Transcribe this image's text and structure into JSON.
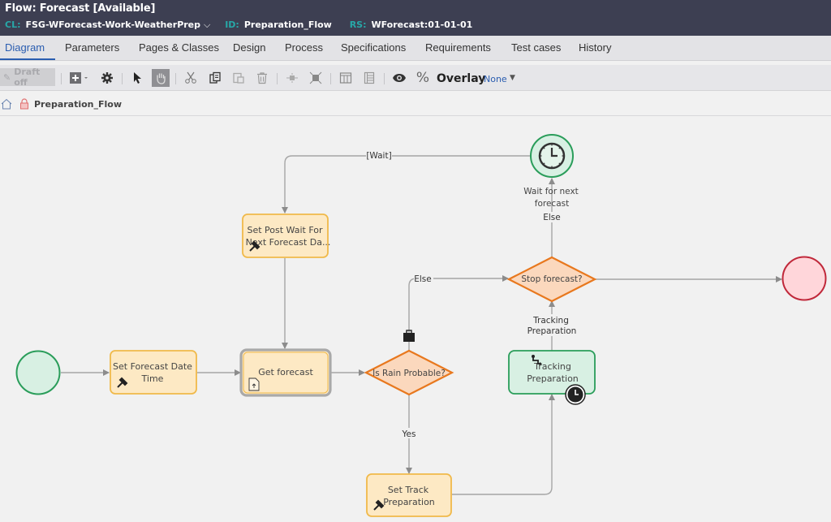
{
  "header": {
    "title": "Flow: Forecast [Available]",
    "cl_label": "CL:",
    "cl_value": "FSG-WForecast-Work-WeatherPrep",
    "id_label": "ID:",
    "id_value": "Preparation_Flow",
    "rs_label": "RS:",
    "rs_value": "WForecast:01-01-01"
  },
  "tabs": [
    {
      "label": "Diagram",
      "active": true
    },
    {
      "label": "Parameters"
    },
    {
      "label": "Pages & Classes"
    },
    {
      "label": "Design"
    },
    {
      "label": "Process"
    },
    {
      "label": "Specifications"
    },
    {
      "label": "Requirements"
    },
    {
      "label": "Test cases"
    },
    {
      "label": "History"
    }
  ],
  "toolbar": {
    "draft_label": "Draft off",
    "icons": [
      "add-shape-icon",
      "settings-gear-icon",
      "select-pointer-icon",
      "pan-hand-icon",
      "cut-icon",
      "copy-icon",
      "paste-icon",
      "delete-icon",
      "align-center-icon",
      "fit-icon",
      "columns-icon",
      "rows-icon",
      "view-eye-icon",
      "percent-icon"
    ],
    "overlay_label": "Overlay",
    "overlay_value": "None"
  },
  "breadcrumb": {
    "name": "Preparation_Flow"
  },
  "diagram": {
    "nodes": {
      "start": {
        "type": "start"
      },
      "set_forecast_date": {
        "label_line1": "Set Forecast Date",
        "label_line2": "Time",
        "type": "utility"
      },
      "get_forecast": {
        "label": "Get forecast",
        "type": "assignment"
      },
      "is_rain_probable": {
        "label": "Is Rain Probable?",
        "type": "decision"
      },
      "set_track_prep": {
        "label_line1": "Set Track",
        "label_line2": "Preparation",
        "type": "utility"
      },
      "tracking_prep": {
        "label_line1": "Tracking",
        "label_line2": "Preparation",
        "type": "subprocess"
      },
      "stop_forecast": {
        "label": "Stop forecast?",
        "type": "decision"
      },
      "wait_next": {
        "label_line1": "Wait for next",
        "label_line2": "forecast",
        "type": "wait"
      },
      "set_post_wait": {
        "label_line1": "Set Post Wait For",
        "label_line2": "Next Forecast Da...",
        "type": "utility"
      },
      "end": {
        "type": "end"
      }
    },
    "connector_labels": {
      "wait": "[Wait]",
      "else_stop": "Else",
      "else_rain": "Else",
      "yes": "Yes",
      "tracking_line1": "Tracking",
      "tracking_line2": "Preparation"
    },
    "colors": {
      "connector": "#9a9a9a",
      "utility_fill": "#fde9c4",
      "utility_stroke": "#f0b94a",
      "decision_fill": "#fbd8bd",
      "decision_stroke": "#e8781e",
      "start_fill": "#d8f0e3",
      "start_stroke": "#2a9d5a",
      "end_fill": "#ffd6da",
      "end_stroke": "#c0283a"
    }
  }
}
